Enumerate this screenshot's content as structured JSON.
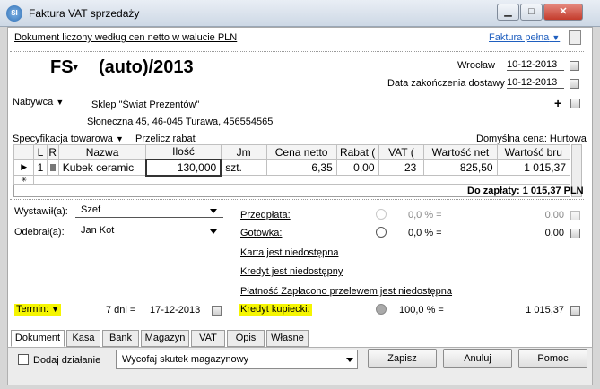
{
  "window": {
    "title": "Faktura VAT sprzedaży",
    "icon_text": "SI"
  },
  "header": {
    "pricing_note": "Dokument liczony według cen netto w walucie PLN",
    "invoice_type": "Faktura pełna",
    "doc_prefix": "FS",
    "doc_number": "(auto)/2013",
    "place": "Wrocław",
    "date": "10-12-2013",
    "delivery_label": "Data zakończenia dostawy",
    "delivery_date": "10-12-2013"
  },
  "buyer": {
    "label": "Nabywca",
    "name": "Sklep \"Świat Prezentów\"",
    "address": "Słoneczna  45, 46-045 Turawa, 456554565"
  },
  "items": {
    "spec_label": "Specyfikacja towarowa",
    "recalc_label": "Przelicz rabat",
    "default_price": "Domyślna cena: Hurtowa",
    "columns": [
      "L",
      "R",
      "Nazwa",
      "Ilość",
      "Jm",
      "Cena netto",
      "Rabat (",
      "VAT (",
      "Wartość net",
      "Wartość bru"
    ],
    "rows": [
      {
        "lp": "1",
        "name": "Kubek ceramic",
        "qty": "130,000",
        "unit": "szt.",
        "price": "6,35",
        "discount": "0,00",
        "vat": "23",
        "net": "825,50",
        "gross": "1 015,37"
      }
    ],
    "to_pay": "Do zapłaty: 1 015,37 PLN"
  },
  "people": {
    "issued_label": "Wystawił(a):",
    "issued_value": "Szef",
    "received_label": "Odebrał(a):",
    "received_value": "Jan Kot"
  },
  "payments": {
    "prepayment_label": "Przedpłata:",
    "prepayment_pct": "0,0 % =",
    "prepayment_value": "0,00",
    "cash_label": "Gotówka:",
    "cash_pct": "0,0 % =",
    "cash_value": "0,00",
    "card_label": "Karta jest niedostępna",
    "credit_label": "Kredyt jest niedostępny",
    "transfer_label": "Płatność Zapłacono przelewem jest niedostępna",
    "merchant_credit_label": "Kredyt kupiecki:",
    "merchant_credit_pct": "100,0 % =",
    "merchant_credit_value": "1 015,37"
  },
  "term": {
    "label": "Termin:",
    "days": "7 dni =",
    "date": "17-12-2013"
  },
  "tabs": [
    "Dokument",
    "Kasa",
    "Bank",
    "Magazyn",
    "VAT",
    "Opis",
    "Własne"
  ],
  "footer": {
    "add_action": "Dodaj działanie",
    "warehouse_effect": "Wycofaj skutek magazynowy",
    "save": "Zapisz",
    "cancel": "Anuluj",
    "help": "Pomoc"
  },
  "colors": {
    "highlight": "#f5f500",
    "link": "#1f5fbf"
  }
}
